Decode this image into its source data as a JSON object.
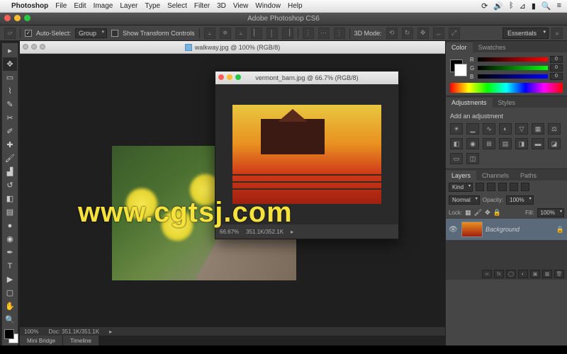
{
  "mac_menu": {
    "app_name": "Photoshop",
    "items": [
      "File",
      "Edit",
      "Image",
      "Layer",
      "Type",
      "Select",
      "Filter",
      "3D",
      "View",
      "Window",
      "Help"
    ]
  },
  "app_title": "Adobe Photoshop CS6",
  "options_bar": {
    "auto_select_label": "Auto-Select:",
    "auto_select_value": "Group",
    "show_transform_label": "Show Transform Controls",
    "mode_3d_label": "3D Mode:",
    "essentials_label": "Essentials"
  },
  "doc_tab": {
    "title": "walkway.jpg @ 100% (RGB/8)"
  },
  "float_doc": {
    "title": "vermont_barn.jpg @ 66.7% (RGB/8)",
    "zoom": "66.67%",
    "doc_info": "351.1K/352.1K"
  },
  "status": {
    "zoom": "100%",
    "doc_info": "Doc: 351.1K/351.1K"
  },
  "bottom_tabs": [
    "Mini Bridge",
    "Timeline"
  ],
  "watermark": "www.cgtsj.com",
  "panels": {
    "color": {
      "tabs": [
        "Color",
        "Swatches"
      ],
      "channels": [
        {
          "label": "R",
          "value": "0"
        },
        {
          "label": "G",
          "value": "0"
        },
        {
          "label": "B",
          "value": "0"
        }
      ]
    },
    "adjustments": {
      "tabs": [
        "Adjustments",
        "Styles"
      ],
      "title": "Add an adjustment"
    },
    "layers": {
      "tabs": [
        "Layers",
        "Channels",
        "Paths"
      ],
      "kind_label": "Kind",
      "blend_mode": "Normal",
      "opacity_label": "Opacity:",
      "opacity_value": "100%",
      "lock_label": "Lock:",
      "fill_label": "Fill:",
      "fill_value": "100%",
      "layer_name": "Background"
    }
  }
}
